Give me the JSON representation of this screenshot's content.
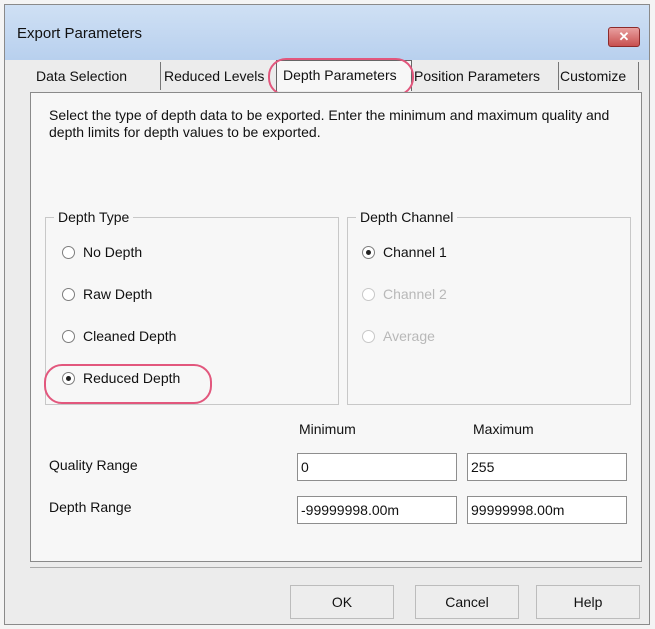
{
  "window": {
    "title": "Export Parameters",
    "close_glyph": "✕"
  },
  "tabs": [
    {
      "label": "Data Selection"
    },
    {
      "label": "Reduced Levels"
    },
    {
      "label": "Depth Parameters",
      "active": true
    },
    {
      "label": "Position Parameters"
    },
    {
      "label": "Customize"
    }
  ],
  "description": "Select the type of depth data to be exported. Enter the minimum and maximum quality and depth limits for depth values to be exported.",
  "depth_type": {
    "title": "Depth Type",
    "options": [
      {
        "label": "No Depth",
        "selected": false
      },
      {
        "label": "Raw Depth",
        "selected": false
      },
      {
        "label": "Cleaned Depth",
        "selected": false
      },
      {
        "label": "Reduced Depth",
        "selected": true
      }
    ]
  },
  "depth_channel": {
    "title": "Depth Channel",
    "options": [
      {
        "label": "Channel 1",
        "selected": true,
        "enabled": true
      },
      {
        "label": "Channel 2",
        "selected": false,
        "enabled": false
      },
      {
        "label": "Average",
        "selected": false,
        "enabled": false
      }
    ]
  },
  "ranges": {
    "min_header": "Minimum",
    "max_header": "Maximum",
    "quality": {
      "label": "Quality Range",
      "min": "0",
      "max": "255"
    },
    "depth": {
      "label": "Depth Range",
      "min": "-99999998.00m",
      "max": "99999998.00m"
    }
  },
  "buttons": {
    "ok": "OK",
    "cancel": "Cancel",
    "help": "Help"
  },
  "colors": {
    "highlight": "#e2577d",
    "title_bar": "#c4d9f2",
    "close": "#c8504f"
  }
}
